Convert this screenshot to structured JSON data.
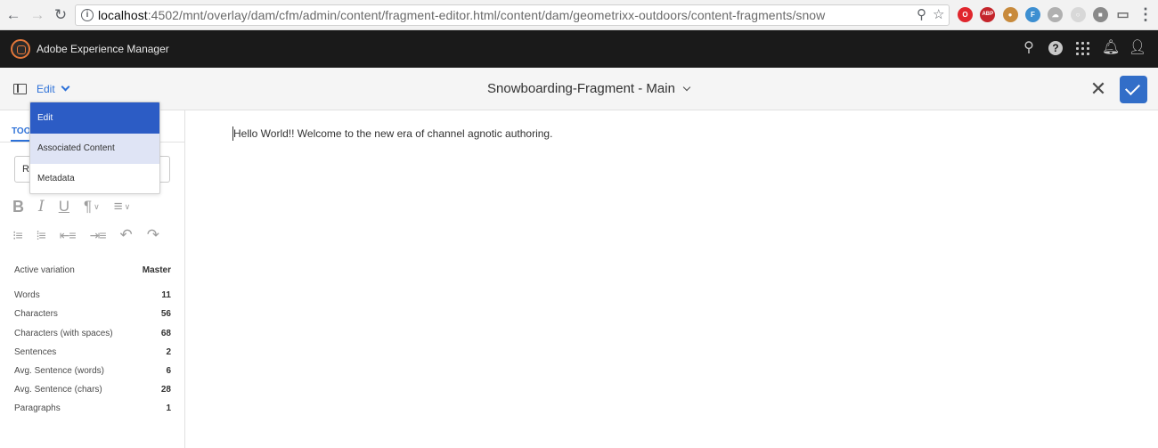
{
  "browser": {
    "url_host": "localhost",
    "url_rest": ":4502/mnt/overlay/dam/cfm/admin/content/fragment-editor.html/content/dam/geometrixx-outdoors/content-fragments/snow",
    "extensions": [
      {
        "name": "opera-extension-icon",
        "color": "#e0262d",
        "glyph": "O"
      },
      {
        "name": "adblock-plus-icon",
        "color": "#c4252b",
        "glyph": "ABP"
      },
      {
        "name": "cookie-icon",
        "color": "#c88a3c",
        "glyph": "●"
      },
      {
        "name": "f-extension-icon",
        "color": "#3d8fd1",
        "glyph": "F"
      },
      {
        "name": "cloud-extension-icon",
        "color": "#b0b0b0",
        "glyph": "☁"
      },
      {
        "name": "circle-extension-icon",
        "color": "#d8d8d8",
        "glyph": "○"
      },
      {
        "name": "square-extension-icon",
        "color": "#8a8a8a",
        "glyph": "■"
      },
      {
        "name": "cast-icon",
        "color": "#6f6f6f",
        "glyph": "▭"
      }
    ]
  },
  "shell": {
    "app_title": "Adobe Experience Manager",
    "icons": [
      "search-icon",
      "help-icon",
      "solutions-grid-icon",
      "notifications-bell-icon",
      "user-profile-icon"
    ]
  },
  "action_bar": {
    "mode_label": "Edit",
    "fragment_title": "Snowboarding-Fragment - Main"
  },
  "mode_menu": {
    "items": [
      {
        "label": "Edit",
        "state": "selected"
      },
      {
        "label": "Associated Content",
        "state": "hover"
      },
      {
        "label": "Metadata",
        "state": "normal"
      }
    ]
  },
  "side_panel": {
    "tab_label": "TOO",
    "format_select_value": "Ri",
    "stats": [
      {
        "label": "Active variation",
        "value": "Master"
      },
      {
        "label": "Words",
        "value": "11"
      },
      {
        "label": "Characters",
        "value": "56"
      },
      {
        "label": "Characters (with spaces)",
        "value": "68"
      },
      {
        "label": "Sentences",
        "value": "2"
      },
      {
        "label": "Avg. Sentence (words)",
        "value": "6"
      },
      {
        "label": "Avg. Sentence (chars)",
        "value": "28"
      },
      {
        "label": "Paragraphs",
        "value": "1"
      }
    ]
  },
  "editor": {
    "text": "Hello World!! Welcome to the new era of channel agnotic authoring."
  },
  "colors": {
    "accent_blue": "#2d71d8",
    "selected_menu": "#2c5cc5",
    "hover_menu": "#dfe4f5",
    "shell_bg": "#1a1a1a",
    "aem_logo": "#e3773a"
  }
}
